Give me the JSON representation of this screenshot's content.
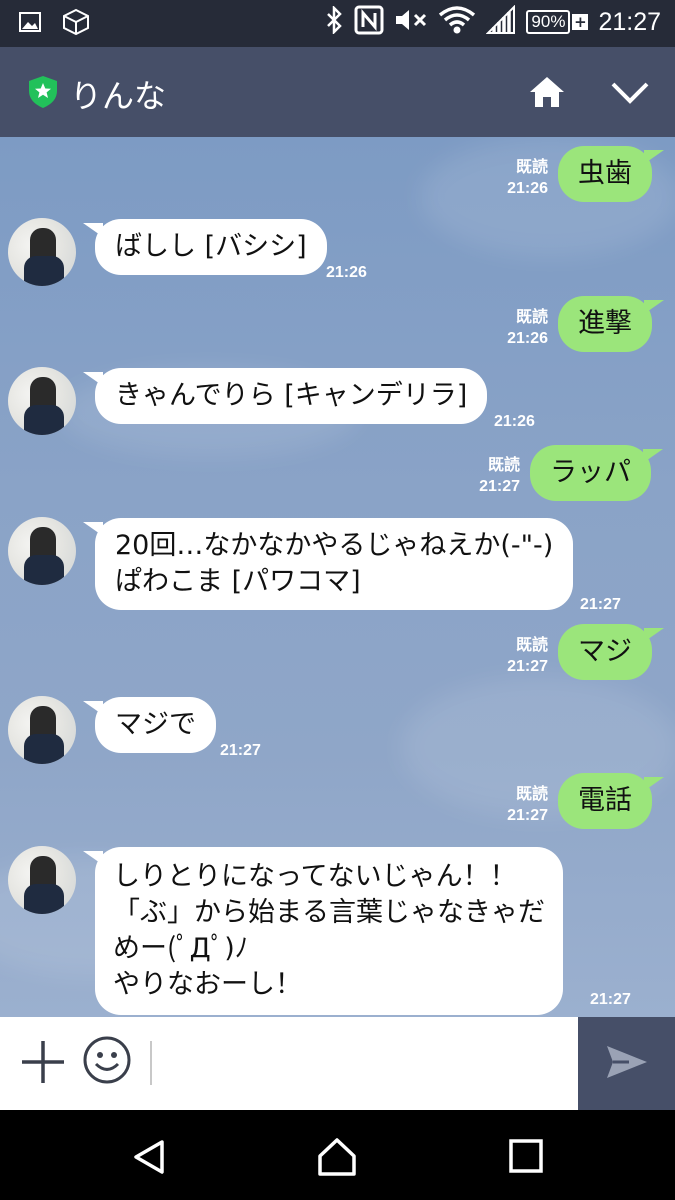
{
  "status_bar": {
    "time": "21:27",
    "battery": "90%",
    "icons": [
      "gallery-icon",
      "app-icon",
      "bluetooth-icon",
      "nfc-icon",
      "mute-icon",
      "wifi-icon",
      "signal-icon",
      "battery-icon"
    ]
  },
  "header": {
    "title": "りんな",
    "badge_icon": "verified-shield-icon",
    "badge_color": "#22c15a",
    "actions": [
      "home-icon",
      "chevron-down-icon"
    ]
  },
  "messages": [
    {
      "from": "me",
      "text": "虫歯",
      "read": "既読",
      "time": "21:26"
    },
    {
      "from": "them",
      "text": "ばしし [バシシ]",
      "time": "21:26"
    },
    {
      "from": "me",
      "text": "進撃",
      "read": "既読",
      "time": "21:26"
    },
    {
      "from": "them",
      "text": "きゃんでりら [キャンデリラ]",
      "time": "21:26"
    },
    {
      "from": "me",
      "text": "ラッパ",
      "read": "既読",
      "time": "21:27"
    },
    {
      "from": "them",
      "text": "20回…なかなかやるじゃねえか(-\"-)\nぱわこま [パワコマ]",
      "time": "21:27"
    },
    {
      "from": "me",
      "text": "マジ",
      "read": "既読",
      "time": "21:27"
    },
    {
      "from": "them",
      "text": "マジで",
      "time": "21:27"
    },
    {
      "from": "me",
      "text": "電話",
      "read": "既読",
      "time": "21:27"
    },
    {
      "from": "them",
      "text": "しりとりになってないじゃん！！\n「ぶ」から始まる言葉じゃなきゃだ\nめー(ﾟДﾟ)ﾉ\nやりなおーし！",
      "time": "21:27"
    }
  ],
  "input_bar": {
    "placeholder": "",
    "icons": [
      "plus-icon",
      "smile-icon",
      "send-icon"
    ]
  },
  "colors": {
    "me_bubble": "#9be57b",
    "them_bubble": "#ffffff",
    "header_bg": "#464f68",
    "chat_bg": "#8aa3c7"
  }
}
